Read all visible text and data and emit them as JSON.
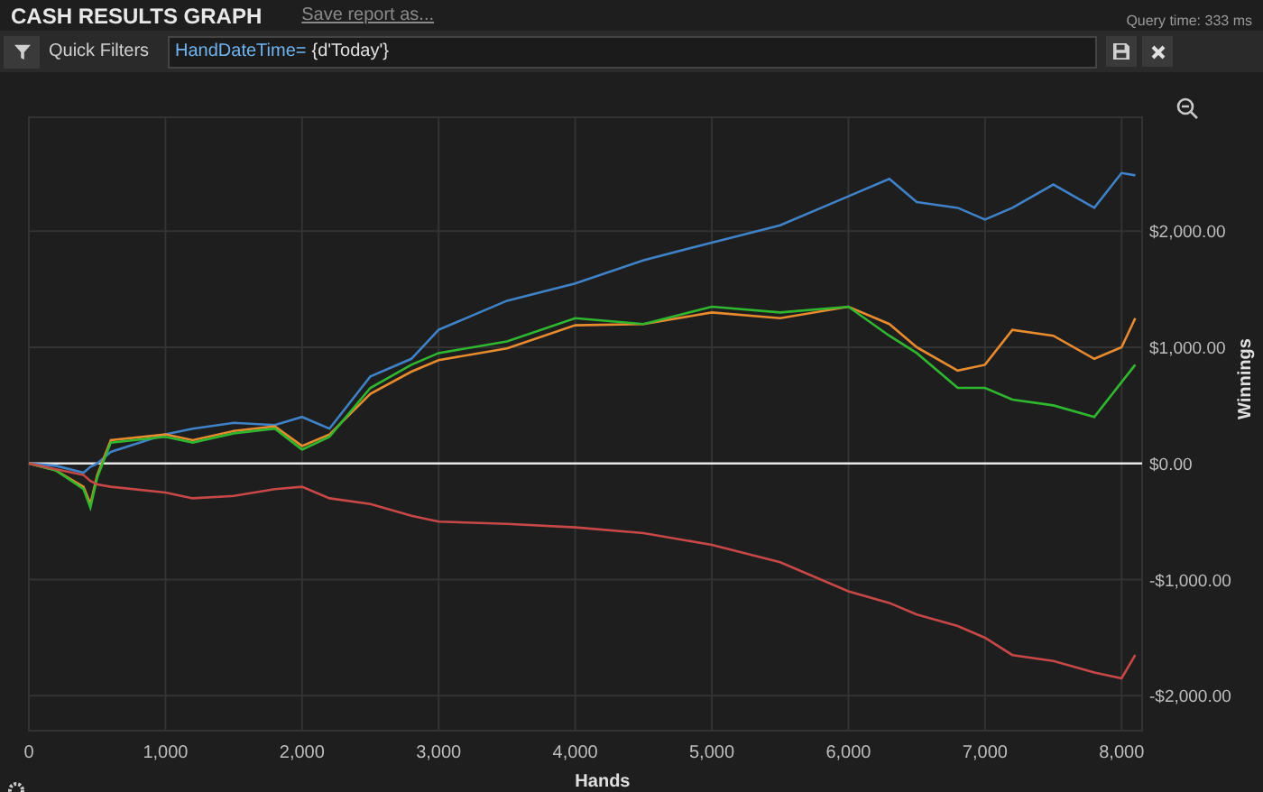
{
  "header": {
    "title": "CASH RESULTS GRAPH",
    "save_link": "Save report as...",
    "query_time": "Query time: 333 ms"
  },
  "filter_bar": {
    "label": "Quick Filters",
    "field_key": "HandDateTime=",
    "field_value": "{d'Today'}"
  },
  "chart": {
    "chart_data": {
      "type": "line",
      "grid": true,
      "xlabel": "Hands",
      "ylabel": "Winnings",
      "x": [
        0,
        200,
        400,
        450,
        500,
        600,
        1000,
        1200,
        1500,
        1800,
        2000,
        2200,
        2500,
        2800,
        3000,
        3500,
        4000,
        4500,
        5000,
        5500,
        6000,
        6300,
        6500,
        6800,
        7000,
        7200,
        7500,
        7800,
        8000,
        8100
      ],
      "series": [
        {
          "color": "#3f82c8",
          "values": [
            0,
            -20,
            -80,
            -30,
            0,
            100,
            250,
            300,
            350,
            330,
            400,
            300,
            750,
            900,
            1150,
            1400,
            1550,
            1750,
            1900,
            2050,
            2300,
            2450,
            2250,
            2200,
            2100,
            2200,
            2400,
            2200,
            2500,
            2480
          ]
        },
        {
          "color": "#e88b2e",
          "values": [
            0,
            -60,
            -200,
            -350,
            -100,
            200,
            250,
            200,
            280,
            320,
            150,
            250,
            600,
            790,
            890,
            990,
            1190,
            1200,
            1300,
            1250,
            1350,
            1200,
            1000,
            800,
            850,
            1150,
            1100,
            900,
            1000,
            1250
          ]
        },
        {
          "color": "#2fb82f",
          "values": [
            0,
            -60,
            -220,
            -380,
            -120,
            180,
            230,
            180,
            260,
            300,
            120,
            230,
            650,
            850,
            950,
            1050,
            1250,
            1200,
            1350,
            1300,
            1350,
            1100,
            950,
            650,
            650,
            550,
            500,
            400,
            700,
            850
          ]
        },
        {
          "color": "#c84848",
          "values": [
            0,
            -50,
            -100,
            -150,
            -180,
            -200,
            -250,
            -300,
            -280,
            -220,
            -200,
            -300,
            -350,
            -450,
            -500,
            -520,
            -550,
            -600,
            -700,
            -850,
            -1100,
            -1200,
            -1300,
            -1400,
            -1500,
            -1650,
            -1700,
            -1800,
            -1850,
            -1650
          ]
        }
      ],
      "xlim": [
        0,
        8150
      ],
      "ylim": [
        -2300,
        2980
      ],
      "xticks": [
        {
          "value": 0,
          "label": "0"
        },
        {
          "value": 1000,
          "label": "1,000"
        },
        {
          "value": 2000,
          "label": "2,000"
        },
        {
          "value": 3000,
          "label": "3,000"
        },
        {
          "value": 4000,
          "label": "4,000"
        },
        {
          "value": 5000,
          "label": "5,000"
        },
        {
          "value": 6000,
          "label": "6,000"
        },
        {
          "value": 7000,
          "label": "7,000"
        },
        {
          "value": 8000,
          "label": "8,000"
        }
      ],
      "yticks": [
        {
          "value": 2000,
          "label": "$2,000.00"
        },
        {
          "value": 1000,
          "label": "$1,000.00"
        },
        {
          "value": 0,
          "label": "$0.00"
        },
        {
          "value": -1000,
          "label": "-$1,000.00"
        },
        {
          "value": -2000,
          "label": "-$2,000.00"
        }
      ]
    }
  }
}
